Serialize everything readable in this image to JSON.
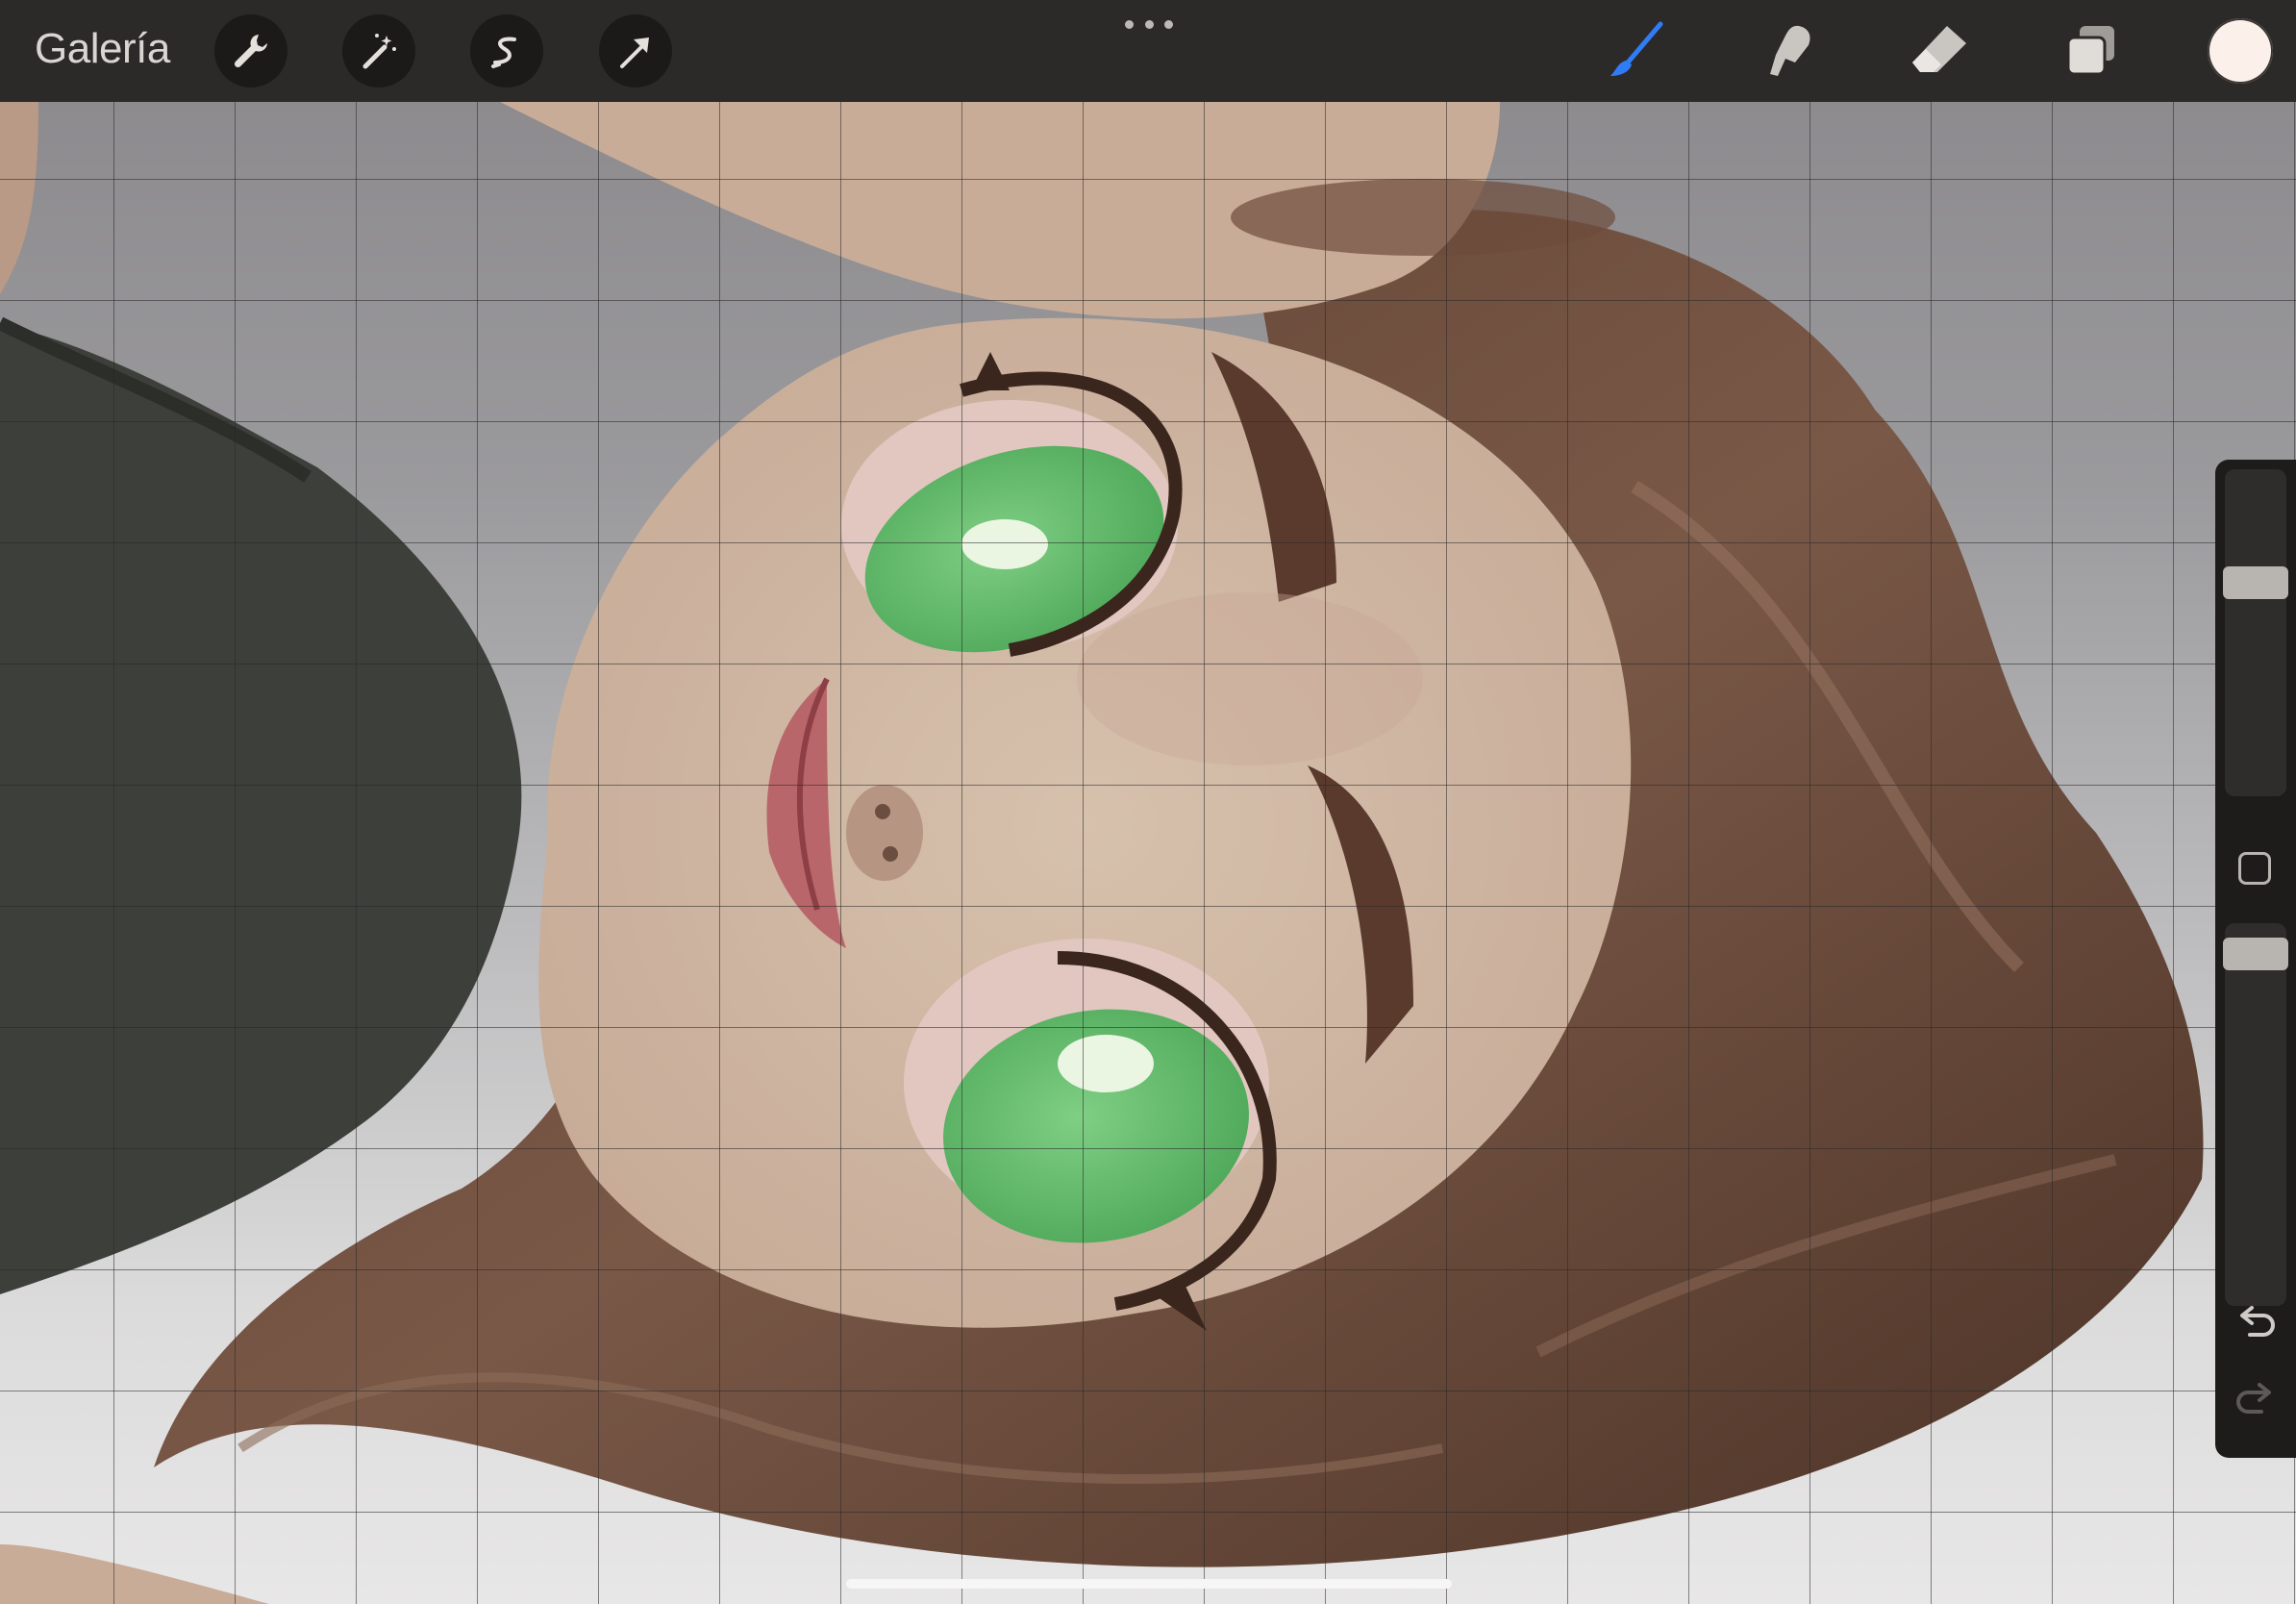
{
  "topbar": {
    "gallery_label": "Galería",
    "actions_tool": "wrench-icon",
    "adjustments_tool": "magic-wand-icon",
    "selection_tool": "selection-s-icon",
    "transform_tool": "arrow-cursor-icon",
    "more_menu": "ellipsis-icon",
    "brush_tool": "brush-icon",
    "smudge_tool": "smudge-finger-icon",
    "eraser_tool": "eraser-icon",
    "layers_tool": "layers-icon",
    "active_color": "#fbf1ea",
    "accent_color": "#2f7cf6"
  },
  "sidebar": {
    "brush_size_level": 0.33,
    "opacity_level": 0.04,
    "modify_button": "square-icon",
    "undo": "undo-arrow-icon",
    "redo": "redo-arrow-icon"
  },
  "canvas": {
    "grid_visible": true,
    "background_colors": [
      "#8d8b8e",
      "#e8e7e7"
    ]
  }
}
